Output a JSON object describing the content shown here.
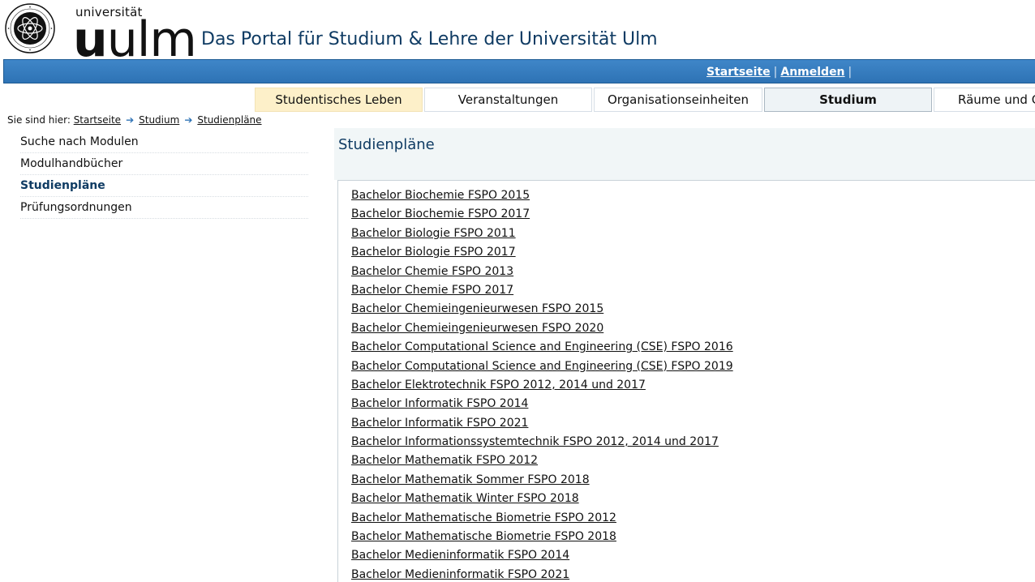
{
  "header": {
    "logo_small": "universität",
    "logo_big_bold": "u",
    "logo_big_rest": "ulm",
    "portal_title": "Das Portal für Studium & Lehre der Universität Ulm"
  },
  "topbar": {
    "links": [
      {
        "label": "Startseite"
      },
      {
        "label": "Anmelden"
      }
    ],
    "separator": "|"
  },
  "tabs": [
    {
      "label": "Studentisches Leben",
      "state": "highlight"
    },
    {
      "label": "Veranstaltungen",
      "state": "normal"
    },
    {
      "label": "Organisationseinheiten",
      "state": "normal"
    },
    {
      "label": "Studium",
      "state": "active"
    },
    {
      "label": "Räume und G",
      "state": "normal"
    }
  ],
  "breadcrumb": {
    "prefix": "Sie sind hier:",
    "items": [
      "Startseite",
      "Studium",
      "Studienpläne"
    ]
  },
  "sidebar": {
    "items": [
      {
        "label": "Suche nach Modulen",
        "active": false
      },
      {
        "label": "Modulhandbücher",
        "active": false
      },
      {
        "label": "Studienpläne",
        "active": true
      },
      {
        "label": "Prüfungsordnungen",
        "active": false
      }
    ]
  },
  "main": {
    "title": "Studienpläne",
    "plans": [
      "Bachelor Biochemie FSPO 2015",
      "Bachelor Biochemie FSPO 2017",
      "Bachelor Biologie FSPO 2011",
      "Bachelor Biologie FSPO 2017",
      "Bachelor Chemie FSPO 2013",
      "Bachelor Chemie FSPO 2017",
      "Bachelor Chemieingenieurwesen FSPO 2015",
      "Bachelor Chemieingenieurwesen FSPO 2020",
      "Bachelor Computational Science and Engineering (CSE) FSPO 2016",
      "Bachelor Computational Science and Engineering (CSE) FSPO 2019",
      "Bachelor Elektrotechnik FSPO 2012, 2014 und 2017",
      "Bachelor Informatik FSPO 2014",
      "Bachelor Informatik FSPO 2021",
      "Bachelor Informationssystemtechnik FSPO 2012, 2014 und 2017",
      "Bachelor Mathematik FSPO 2012",
      "Bachelor Mathematik Sommer FSPO 2018",
      "Bachelor Mathematik Winter FSPO 2018",
      "Bachelor Mathematische Biometrie FSPO 2012",
      "Bachelor Mathematische Biometrie FSPO 2018",
      "Bachelor Medieninformatik FSPO 2014",
      "Bachelor Medieninformatik FSPO 2021"
    ]
  },
  "colors": {
    "topbar_blue": "#2e73b5",
    "title_blue": "#0f3b63",
    "tab_highlight": "#fdf0c9",
    "tab_active": "#eef3f6",
    "content_head_bg": "#f1f6f7"
  },
  "icons": {
    "breadcrumb_separator": "arrow-right-icon",
    "seal": "university-seal-icon"
  }
}
